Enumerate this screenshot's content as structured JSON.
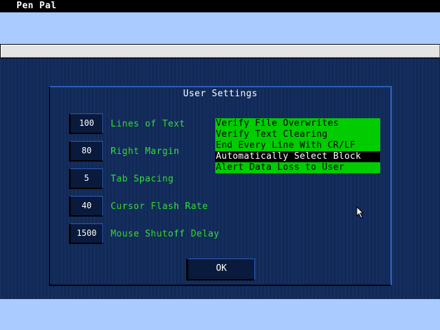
{
  "app": {
    "title": "Pen Pal"
  },
  "dialog": {
    "title": "User Settings",
    "settings": [
      {
        "value": "100",
        "label": "Lines of Text"
      },
      {
        "value": "80",
        "label": "Right Margin"
      },
      {
        "value": "5",
        "label": "Tab Spacing"
      },
      {
        "value": "40",
        "label": "Cursor Flash Rate"
      },
      {
        "value": "1500",
        "label": "Mouse Shutoff Delay"
      }
    ],
    "options": [
      {
        "label": "Verify File Overwrites",
        "selected": false
      },
      {
        "label": "Verify Text Clearing",
        "selected": false
      },
      {
        "label": "End Every Line With CR/LF",
        "selected": false
      },
      {
        "label": "Automatically Select Block",
        "selected": true
      },
      {
        "label": "Alert Data Loss to User",
        "selected": false
      }
    ],
    "ok_label": "OK"
  },
  "colors": {
    "menu_band": "#aacbff",
    "workspace": "#17346a",
    "option_on": "#00cc00",
    "label_green": "#33dd33"
  },
  "icons": {
    "pointer": "mouse-pointer-icon"
  }
}
